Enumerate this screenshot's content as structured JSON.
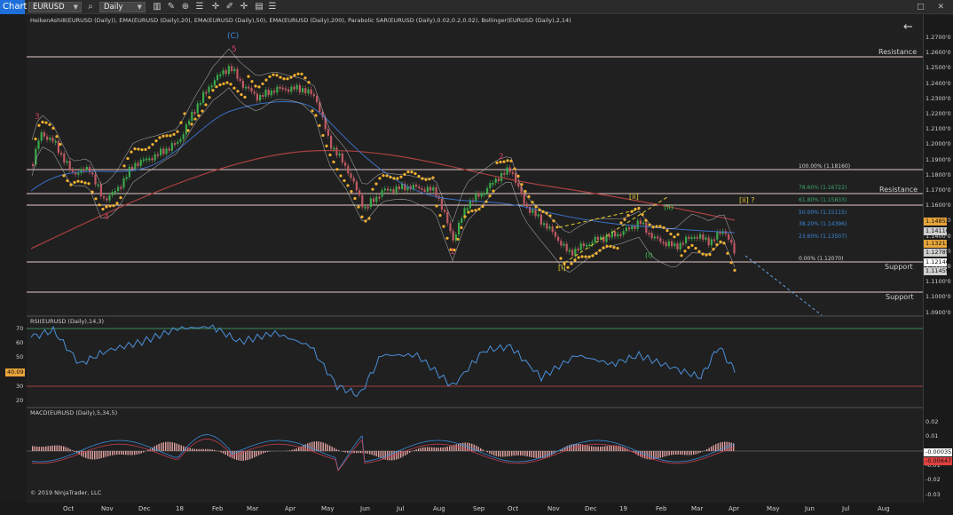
{
  "toolbar": {
    "tab_label": "Chart",
    "instrument": "EURUSD",
    "period": "Daily",
    "window_controls": "□ ✕"
  },
  "chart": {
    "price_title": "HeikenAshi8(EURUSD (Daily)), EMA(EURUSD (Daily),20), EMA(EURUSD (Daily),50), EMA(EURUSD (Daily),200), Parabolic SAR(EURUSD (Daily),0.02,0.2,0.02), Bollinger(EURUSD (Daily),2,14)",
    "rsi_title": "RSI(EURUSD (Daily),14,3)",
    "macd_title": "MACD(EURUSD (Daily),5,34,5)",
    "copyright": "© 2019 NinjaTrader, LLC",
    "back_arrow": "←"
  },
  "price_axis": [
    "1.2700'0",
    "1.2600'0",
    "1.2500'0",
    "1.2400'0",
    "1.2300'0",
    "1.2200'0",
    "1.2100'0",
    "1.2000'0",
    "1.1900'0",
    "1.1800'0",
    "1.1700'0",
    "1.1600'0",
    "1.1500'0",
    "1.1400'0",
    "1.1300'0",
    "1.1200'0",
    "1.1100'0",
    "1.1000'0",
    "1.0900'0"
  ],
  "price_tags": [
    {
      "label": "1.14852",
      "color": "#e8a53a"
    },
    {
      "label": "1.14110",
      "color": "#cfcfcf"
    },
    {
      "label": "1.13213",
      "color": "#e8a53a"
    },
    {
      "label": "1.12785",
      "color": "#cfcfcf"
    },
    {
      "label": "1.12146",
      "color": "#ffffff"
    },
    {
      "label": "1.11459",
      "color": "#cfcfcf"
    }
  ],
  "levels": {
    "resistance_top": "Resistance",
    "resistance_mid": "Resistance",
    "support_1": "Support",
    "support_2": "Support"
  },
  "fibonacci": [
    {
      "label": "100.00% (1.18160)",
      "color": "#cfcfcf"
    },
    {
      "label": "78.60% (1.16722)",
      "color": "#3aa86b"
    },
    {
      "label": "61.80% (1.15833)",
      "color": "#3aa86b"
    },
    {
      "label": "50.00% (1.15115)",
      "color": "#3a8ad9"
    },
    {
      "label": "38.20% (1.14396)",
      "color": "#3a8ad9"
    },
    {
      "label": "23.60% (1.13507)",
      "color": "#3a8ad9"
    },
    {
      "label": "0.00% (1.12070)",
      "color": "#cfcfcf"
    }
  ],
  "waves": {
    "w_C": "(C)",
    "w_5": "5",
    "w_3": "3",
    "w_4": "4",
    "w_1": "1",
    "w_2": "2",
    "w_i_bracket": "[i]",
    "w_ii_bracket": "[ii]",
    "w_ii_q": "[ii] ?",
    "w_i_paren": "(i)",
    "w_ii_paren": "(ii)"
  },
  "rsi_axis": [
    "70",
    "60",
    "50",
    "40",
    "30",
    "20"
  ],
  "rsi_current": "40.09",
  "macd_axis": [
    "0.02",
    "0.01",
    "0",
    "-0.01",
    "-0.02",
    "-0.03"
  ],
  "macd_tags": [
    {
      "label": "-0.000353",
      "color": "#ffffff"
    },
    {
      "label": "-0.00647",
      "color": "#e04040"
    }
  ],
  "time_axis": [
    "Oct",
    "Nov",
    "Dec",
    "18",
    "Feb",
    "Mar",
    "Apr",
    "May",
    "Jun",
    "Jul",
    "Aug",
    "Sep",
    "Oct",
    "Nov",
    "Dec",
    "19",
    "Feb",
    "Mar",
    "Apr",
    "May",
    "Jun",
    "Jul",
    "Aug"
  ],
  "colors": {
    "up_candle": "#3aa84a",
    "down_candle": "#c05a64",
    "sar": "#f0b030",
    "ema200": "#a84040",
    "ema50": "#3a70c8",
    "bollinger": "#cfcfcf"
  }
}
